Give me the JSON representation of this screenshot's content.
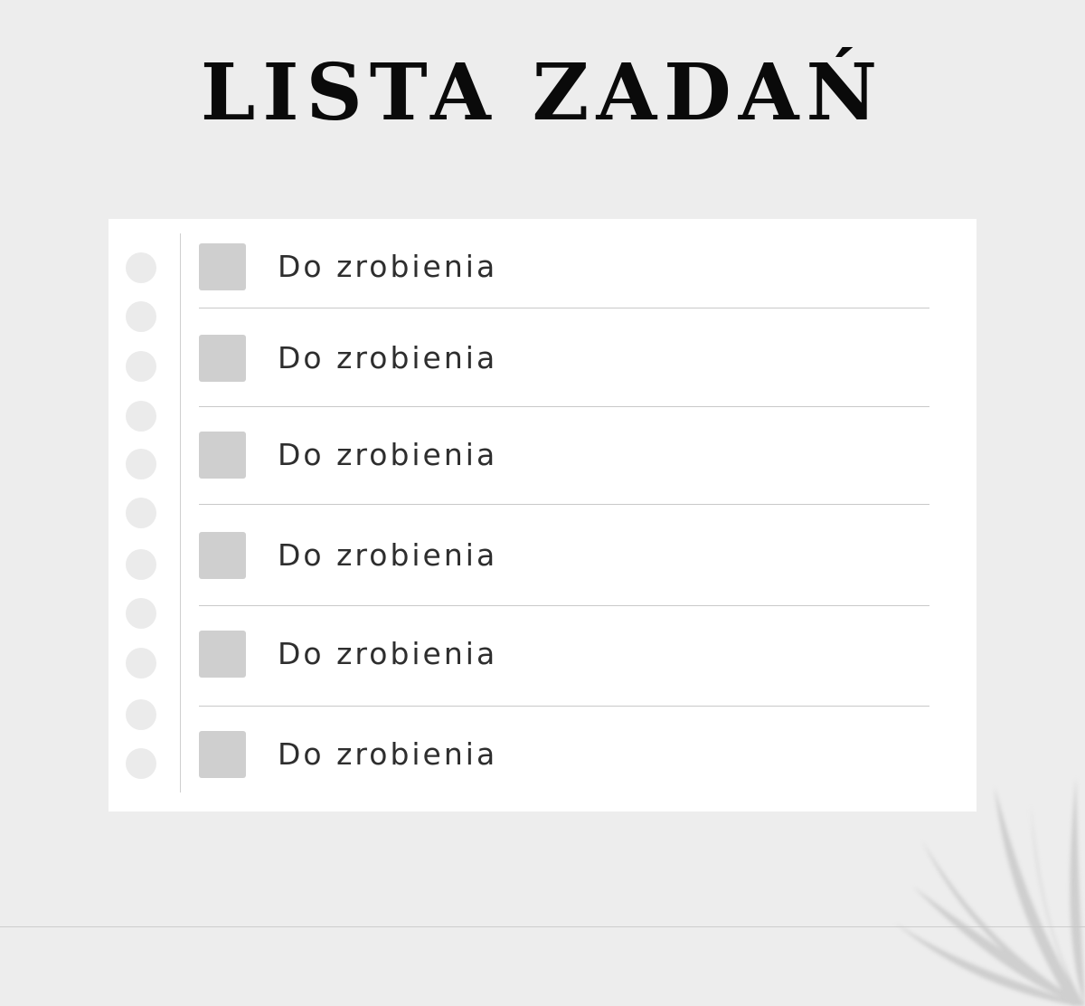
{
  "title": "LISTA ZADAŃ",
  "tasks": [
    {
      "label": "Do zrobienia",
      "checked": false
    },
    {
      "label": "Do zrobienia",
      "checked": false
    },
    {
      "label": "Do zrobienia",
      "checked": false
    },
    {
      "label": "Do zrobienia",
      "checked": false
    },
    {
      "label": "Do zrobienia",
      "checked": false
    },
    {
      "label": "Do zrobienia",
      "checked": false
    }
  ],
  "colors": {
    "background": "#ededed",
    "card": "#ffffff",
    "checkbox": "#cfcfcf",
    "text": "#2e2e2e",
    "title": "#0a0a0a"
  }
}
